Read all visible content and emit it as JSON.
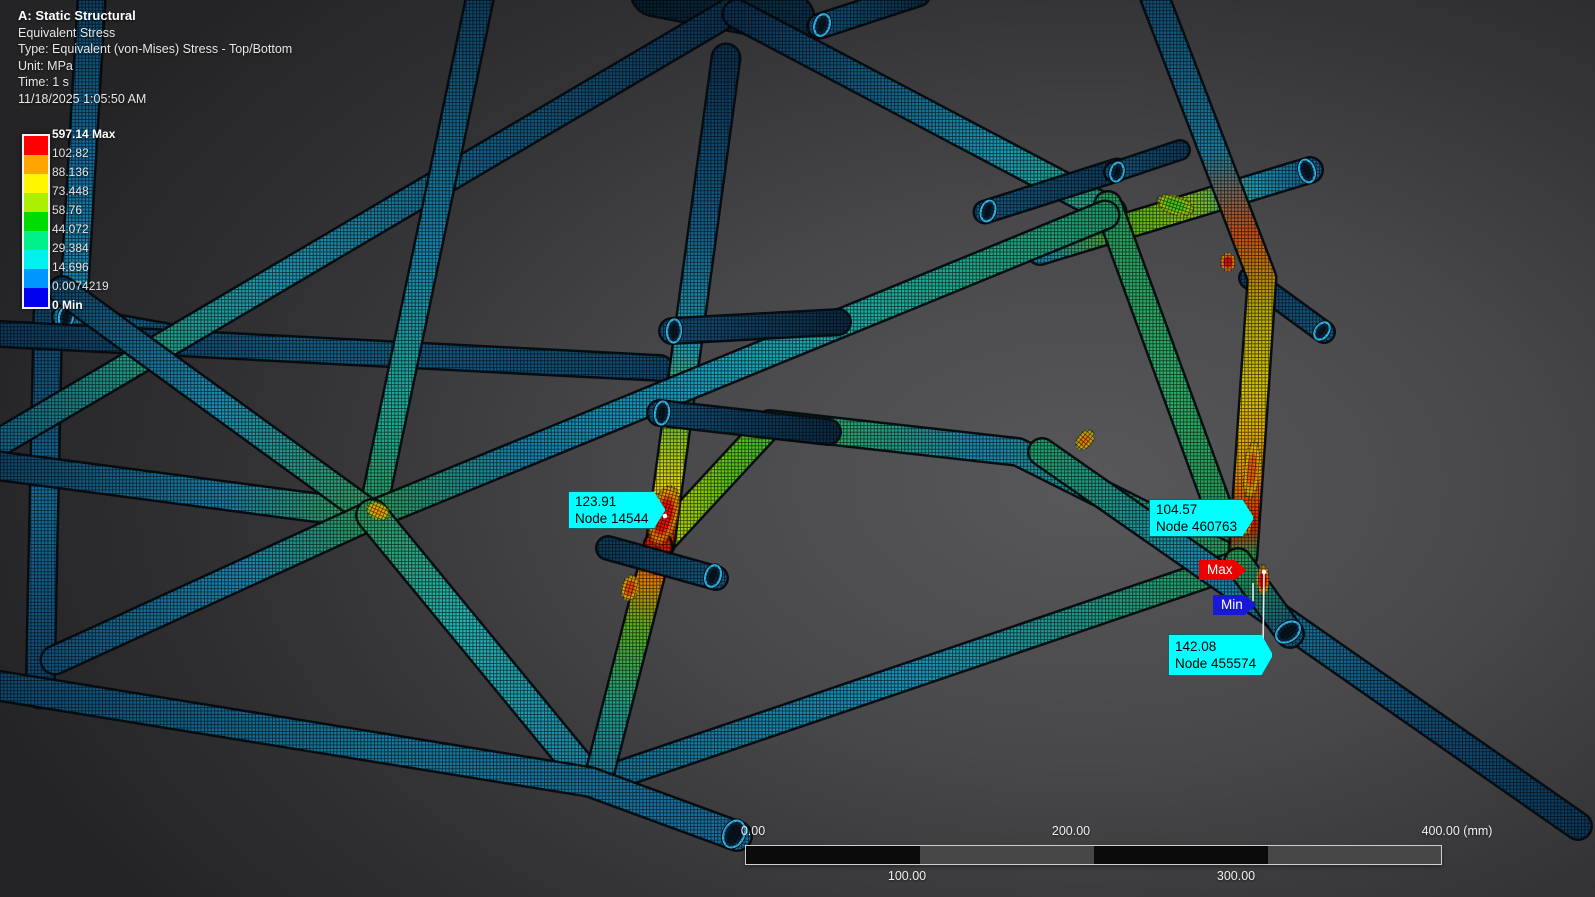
{
  "header": {
    "title": "A: Static Structural",
    "result": "Equivalent Stress",
    "type_line": "Type: Equivalent (von-Mises) Stress - Top/Bottom",
    "unit_line": "Unit: MPa",
    "time_line": "Time: 1 s",
    "datetime": "11/18/2025 1:05:50 AM"
  },
  "legend": {
    "entries": [
      "597.14 Max",
      "102.82",
      "88.136",
      "73.448",
      "58.76",
      "44.072",
      "29.384",
      "14.696",
      "0.0074219",
      "0 Min"
    ],
    "colors": [
      "#ff0000",
      "#ffa500",
      "#fff600",
      "#aaf000",
      "#00dc00",
      "#00f08c",
      "#00f0f0",
      "#0096ff",
      "#0000f0"
    ]
  },
  "probes": [
    {
      "value": "123.91",
      "node": "Node 14544"
    },
    {
      "value": "104.57",
      "node": "Node 460763"
    },
    {
      "value": "142.08",
      "node": "Node 455574"
    }
  ],
  "markers": {
    "max_label": "Max",
    "min_label": "Min"
  },
  "ruler": {
    "top_labels": [
      "0.00",
      "200.00",
      "400.00 (mm)"
    ],
    "bottom_labels": [
      "100.00",
      "300.00"
    ]
  },
  "colors": {
    "probe_flag": "#00ffff",
    "max_flag": "#ec0000",
    "min_flag": "#1818d8",
    "mesh_line": "#000000"
  }
}
